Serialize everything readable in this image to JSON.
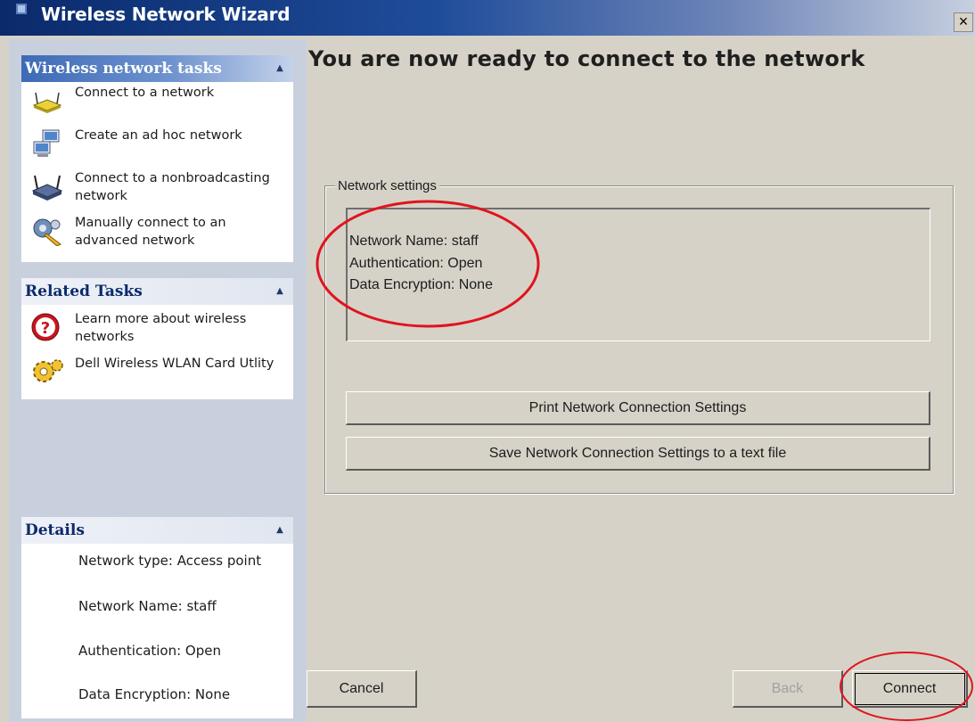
{
  "window": {
    "title": "Wireless Network Wizard",
    "close_label": "×"
  },
  "sidebar": {
    "tasks_panel": {
      "title": "Wireless network tasks",
      "items": [
        {
          "label": "Connect to a network",
          "icon": "router-icon"
        },
        {
          "label": "Create an ad hoc network",
          "icon": "computers-icon"
        },
        {
          "label": "Connect to a nonbroadcasting network",
          "icon": "wireless-router-icon"
        },
        {
          "label": "Manually connect to an advanced network",
          "icon": "network-tools-icon"
        }
      ]
    },
    "related_panel": {
      "title": "Related Tasks",
      "items": [
        {
          "label": "Learn more about wireless networks",
          "icon": "help-icon"
        },
        {
          "label": "Dell Wireless WLAN Card Utlity",
          "icon": "gear-icon"
        }
      ]
    },
    "details_panel": {
      "title": "Details",
      "items": [
        "Network type: Access point",
        "Network Name: staff",
        "Authentication: Open",
        "Data Encryption: None"
      ]
    }
  },
  "main": {
    "heading": "You are now ready to connect to the network",
    "settings_group_label": "Network settings",
    "settings_lines": [
      "Network Name: staff",
      "Authentication: Open",
      "Data Encryption: None"
    ],
    "print_button": "Print Network Connection Settings",
    "save_button": "Save Network Connection Settings to a text file"
  },
  "footer": {
    "cancel": "Cancel",
    "back": "Back",
    "connect": "Connect"
  },
  "colors": {
    "title_bar": "#0a2a6b",
    "dialog_bg": "#d6d2c8",
    "sidebar_bg": "#c9d0dd",
    "annotation": "#e0141e"
  }
}
